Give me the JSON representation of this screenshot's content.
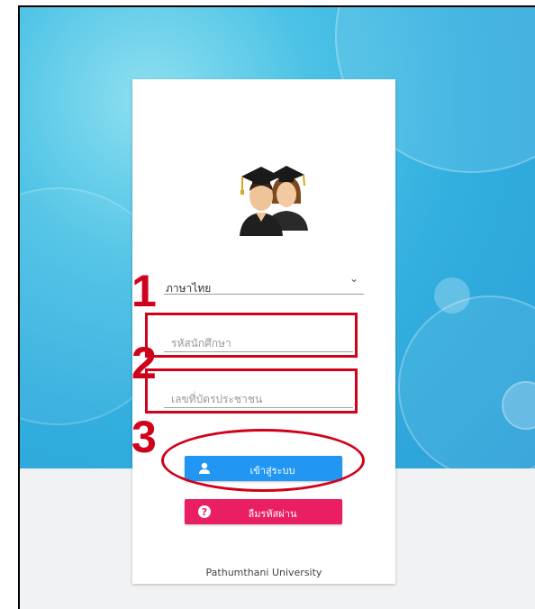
{
  "login": {
    "language_select": {
      "value": "ภาษาไทย"
    },
    "student_id": {
      "placeholder": "รหัสนักศึกษา"
    },
    "national_id": {
      "placeholder": "เลขที่บัตรประชาชน"
    },
    "login_button": {
      "label": "เข้าสู่ระบบ",
      "icon": "user-icon",
      "color": "#2196f3"
    },
    "forgot_button": {
      "label": "ลืมรหัสผ่าน",
      "icon": "question-icon",
      "color": "#e91e63"
    },
    "footer": "Pathumthani University"
  },
  "annotations": {
    "step1": "1",
    "step2": "2",
    "step3": "3",
    "color": "#d0021b"
  }
}
